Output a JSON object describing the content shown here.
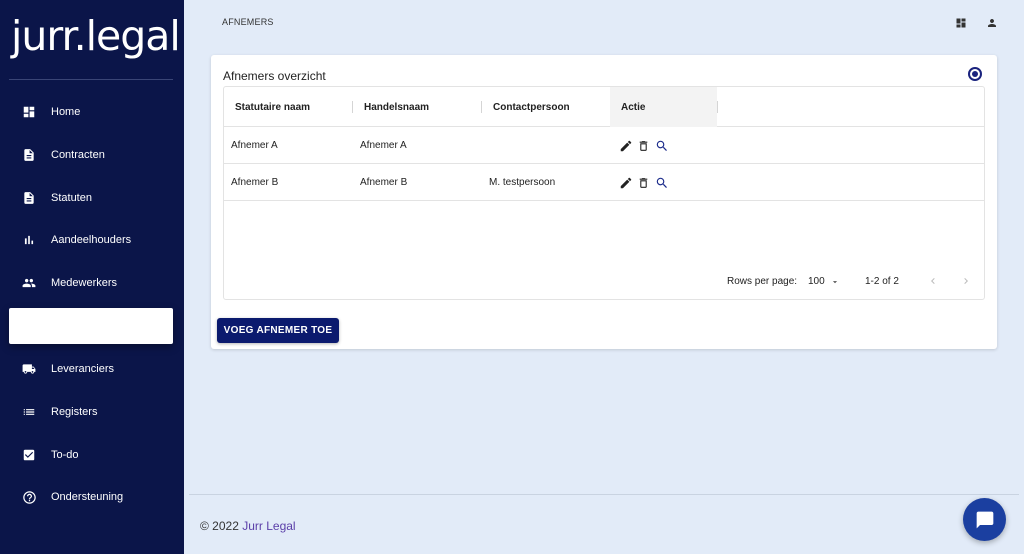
{
  "brand": {
    "logo_text": "jurr.legal"
  },
  "sidebar": {
    "items": [
      {
        "label": "Home",
        "icon": "dashboard-icon"
      },
      {
        "label": "Contracten",
        "icon": "document-icon"
      },
      {
        "label": "Statuten",
        "icon": "document-icon"
      },
      {
        "label": "Aandeelhouders",
        "icon": "bar-chart-icon"
      },
      {
        "label": "Medewerkers",
        "icon": "people-icon"
      },
      {
        "label": "",
        "icon": "",
        "active": true
      },
      {
        "label": "Leveranciers",
        "icon": "truck-icon"
      },
      {
        "label": "Registers",
        "icon": "list-icon"
      },
      {
        "label": "To-do",
        "icon": "checkbox-icon"
      },
      {
        "label": "Ondersteuning",
        "icon": "help-circle-icon"
      }
    ]
  },
  "header": {
    "breadcrumb": "AFNEMERS"
  },
  "card": {
    "title": "Afnemers overzicht",
    "table": {
      "columns": [
        "Statutaire naam",
        "Handelsnaam",
        "Contactpersoon",
        "Actie"
      ],
      "rows": [
        {
          "statutaire_naam": "Afnemer A",
          "handelsnaam": "Afnemer A",
          "contactpersoon": ""
        },
        {
          "statutaire_naam": "Afnemer B",
          "handelsnaam": "Afnemer B",
          "contactpersoon": "M. testpersoon"
        }
      ]
    },
    "pagination": {
      "rows_per_page_label": "Rows per page:",
      "rows_per_page_value": "100",
      "range_text": "1-2 of 2"
    },
    "add_button_label": "VOEG AFNEMER TOE"
  },
  "footer": {
    "copyright": "© 2022",
    "company_link": "Jurr Legal"
  },
  "colors": {
    "sidebar_bg": "#0b1549",
    "page_bg": "#e2ebf8",
    "primary": "#0b1a6e",
    "link": "#5a3ea8"
  }
}
